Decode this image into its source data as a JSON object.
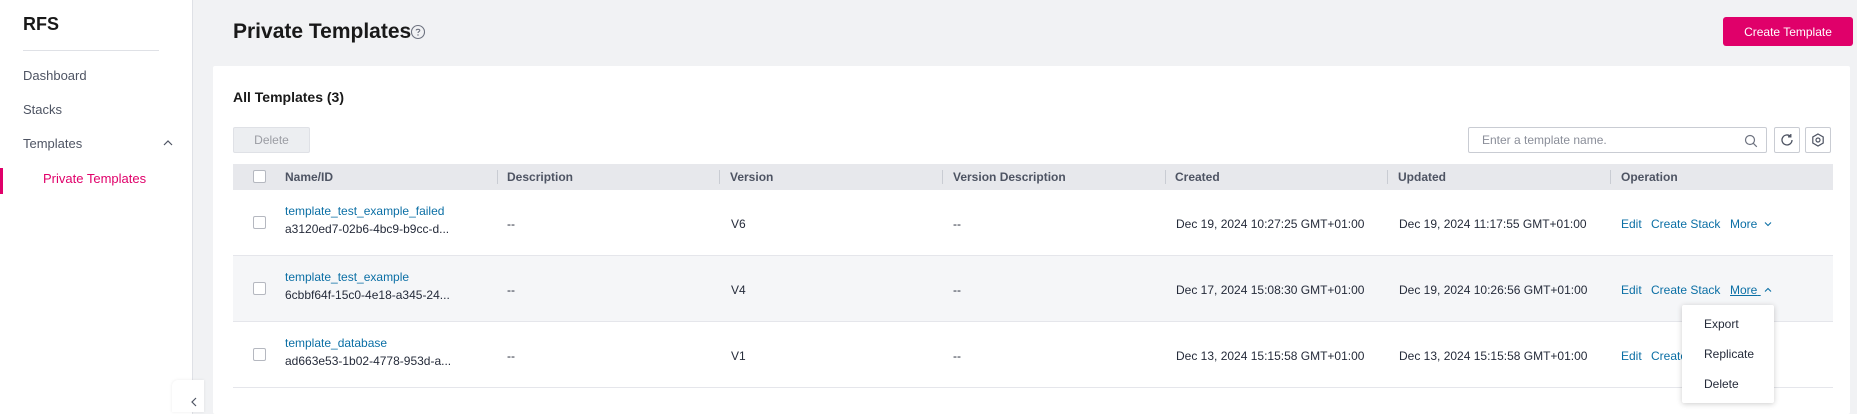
{
  "sidebar": {
    "brand": "RFS",
    "items": [
      {
        "label": "Dashboard"
      },
      {
        "label": "Stacks"
      },
      {
        "label": "Templates"
      },
      {
        "label": "Private Templates"
      }
    ]
  },
  "header": {
    "title": "Private Templates",
    "create_button": "Create Template"
  },
  "card": {
    "title": "All Templates (3)",
    "delete_button": "Delete",
    "search_placeholder": "Enter a template name."
  },
  "table": {
    "columns": [
      "Name/ID",
      "Description",
      "Version",
      "Version Description",
      "Created",
      "Updated",
      "Operation"
    ],
    "rows": [
      {
        "name": "template_test_example_failed",
        "id": "a3120ed7-02b6-4bc9-b9cc-d...",
        "description": "--",
        "version": "V6",
        "version_description": "--",
        "created": "Dec 19, 2024 10:27:25 GMT+01:00",
        "updated": "Dec 19, 2024 11:17:55 GMT+01:00"
      },
      {
        "name": "template_test_example",
        "id": "6cbbf64f-15c0-4e18-a345-24...",
        "description": "--",
        "version": "V4",
        "version_description": "--",
        "created": "Dec 17, 2024 15:08:30 GMT+01:00",
        "updated": "Dec 19, 2024 10:26:56 GMT+01:00"
      },
      {
        "name": "template_database",
        "id": "ad663e53-1b02-4778-953d-a...",
        "description": "--",
        "version": "V1",
        "version_description": "--",
        "created": "Dec 13, 2024 15:15:58 GMT+01:00",
        "updated": "Dec 13, 2024 15:15:58 GMT+01:00"
      }
    ],
    "operations": {
      "edit": "Edit",
      "create_stack": "Create Stack",
      "create_stack_truncated": "Create",
      "more": "More"
    }
  },
  "more_menu": {
    "items": [
      "Export",
      "Replicate",
      "Delete"
    ]
  },
  "colors": {
    "accent": "#e0006a",
    "link": "#0b6fa5"
  }
}
